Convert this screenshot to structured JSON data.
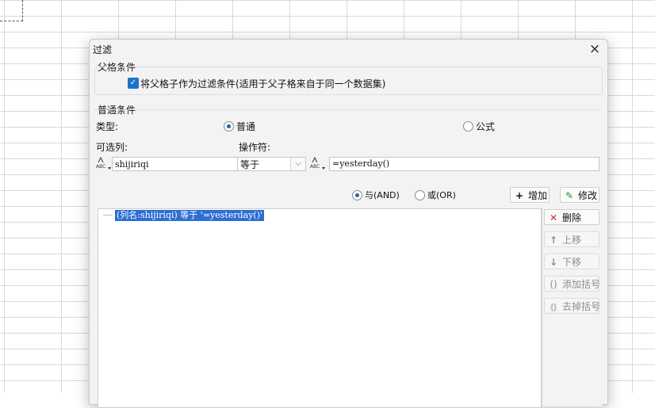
{
  "dialog": {
    "title": "过滤",
    "close_icon": "×"
  },
  "parent_condition": {
    "group_title": "父格条件",
    "checkbox_label": "将父格子作为过滤条件(适用于父子格来自于同一个数据集)",
    "checked": true
  },
  "normal_condition": {
    "group_title": "普通条件",
    "type_label": "类型:",
    "type_options": [
      "普通",
      "公式"
    ],
    "type_selected": "普通",
    "column_label": "可选列:",
    "operator_label": "操作符:",
    "column_value": "shijiriqi",
    "operator_value": "等于",
    "value_text": "=yesterday()",
    "abc_icon_text": "ABC"
  },
  "logic": {
    "and_label": "与(AND)",
    "or_label": "或(OR)",
    "selected": "and"
  },
  "buttons": {
    "add": "增加",
    "modify": "修改",
    "delete": "删除",
    "move_up": "上移",
    "move_down": "下移",
    "add_bracket": "添加括号",
    "remove_bracket": "去掉括号"
  },
  "conditions": [
    "(列名:shijiriqi) 等于 '=yesterday()'"
  ],
  "colors": {
    "accent": "#1a73c9",
    "selection": "#2e6dd3",
    "delete_red": "#d62b2b",
    "modify_green": "#2a8a3a"
  }
}
